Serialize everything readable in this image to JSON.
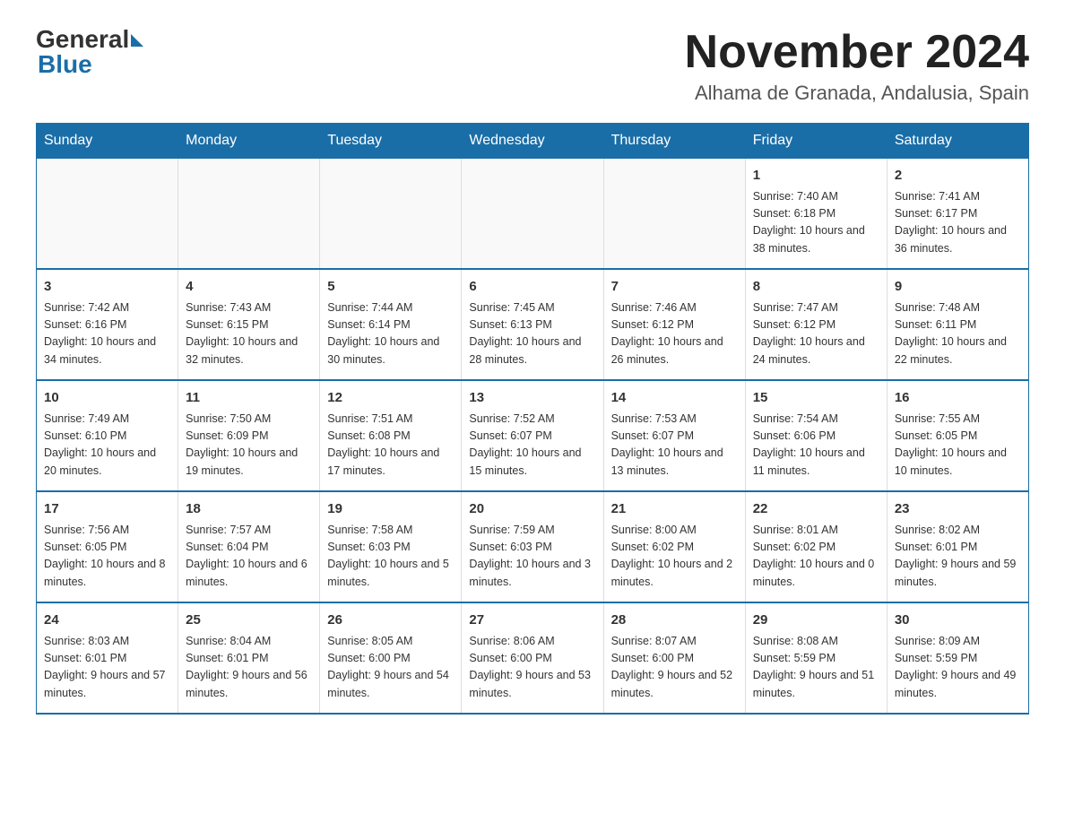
{
  "logo": {
    "general": "General",
    "blue": "Blue"
  },
  "title": "November 2024",
  "subtitle": "Alhama de Granada, Andalusia, Spain",
  "days_of_week": [
    "Sunday",
    "Monday",
    "Tuesday",
    "Wednesday",
    "Thursday",
    "Friday",
    "Saturday"
  ],
  "weeks": [
    [
      {
        "day": "",
        "info": ""
      },
      {
        "day": "",
        "info": ""
      },
      {
        "day": "",
        "info": ""
      },
      {
        "day": "",
        "info": ""
      },
      {
        "day": "",
        "info": ""
      },
      {
        "day": "1",
        "info": "Sunrise: 7:40 AM\nSunset: 6:18 PM\nDaylight: 10 hours and 38 minutes."
      },
      {
        "day": "2",
        "info": "Sunrise: 7:41 AM\nSunset: 6:17 PM\nDaylight: 10 hours and 36 minutes."
      }
    ],
    [
      {
        "day": "3",
        "info": "Sunrise: 7:42 AM\nSunset: 6:16 PM\nDaylight: 10 hours and 34 minutes."
      },
      {
        "day": "4",
        "info": "Sunrise: 7:43 AM\nSunset: 6:15 PM\nDaylight: 10 hours and 32 minutes."
      },
      {
        "day": "5",
        "info": "Sunrise: 7:44 AM\nSunset: 6:14 PM\nDaylight: 10 hours and 30 minutes."
      },
      {
        "day": "6",
        "info": "Sunrise: 7:45 AM\nSunset: 6:13 PM\nDaylight: 10 hours and 28 minutes."
      },
      {
        "day": "7",
        "info": "Sunrise: 7:46 AM\nSunset: 6:12 PM\nDaylight: 10 hours and 26 minutes."
      },
      {
        "day": "8",
        "info": "Sunrise: 7:47 AM\nSunset: 6:12 PM\nDaylight: 10 hours and 24 minutes."
      },
      {
        "day": "9",
        "info": "Sunrise: 7:48 AM\nSunset: 6:11 PM\nDaylight: 10 hours and 22 minutes."
      }
    ],
    [
      {
        "day": "10",
        "info": "Sunrise: 7:49 AM\nSunset: 6:10 PM\nDaylight: 10 hours and 20 minutes."
      },
      {
        "day": "11",
        "info": "Sunrise: 7:50 AM\nSunset: 6:09 PM\nDaylight: 10 hours and 19 minutes."
      },
      {
        "day": "12",
        "info": "Sunrise: 7:51 AM\nSunset: 6:08 PM\nDaylight: 10 hours and 17 minutes."
      },
      {
        "day": "13",
        "info": "Sunrise: 7:52 AM\nSunset: 6:07 PM\nDaylight: 10 hours and 15 minutes."
      },
      {
        "day": "14",
        "info": "Sunrise: 7:53 AM\nSunset: 6:07 PM\nDaylight: 10 hours and 13 minutes."
      },
      {
        "day": "15",
        "info": "Sunrise: 7:54 AM\nSunset: 6:06 PM\nDaylight: 10 hours and 11 minutes."
      },
      {
        "day": "16",
        "info": "Sunrise: 7:55 AM\nSunset: 6:05 PM\nDaylight: 10 hours and 10 minutes."
      }
    ],
    [
      {
        "day": "17",
        "info": "Sunrise: 7:56 AM\nSunset: 6:05 PM\nDaylight: 10 hours and 8 minutes."
      },
      {
        "day": "18",
        "info": "Sunrise: 7:57 AM\nSunset: 6:04 PM\nDaylight: 10 hours and 6 minutes."
      },
      {
        "day": "19",
        "info": "Sunrise: 7:58 AM\nSunset: 6:03 PM\nDaylight: 10 hours and 5 minutes."
      },
      {
        "day": "20",
        "info": "Sunrise: 7:59 AM\nSunset: 6:03 PM\nDaylight: 10 hours and 3 minutes."
      },
      {
        "day": "21",
        "info": "Sunrise: 8:00 AM\nSunset: 6:02 PM\nDaylight: 10 hours and 2 minutes."
      },
      {
        "day": "22",
        "info": "Sunrise: 8:01 AM\nSunset: 6:02 PM\nDaylight: 10 hours and 0 minutes."
      },
      {
        "day": "23",
        "info": "Sunrise: 8:02 AM\nSunset: 6:01 PM\nDaylight: 9 hours and 59 minutes."
      }
    ],
    [
      {
        "day": "24",
        "info": "Sunrise: 8:03 AM\nSunset: 6:01 PM\nDaylight: 9 hours and 57 minutes."
      },
      {
        "day": "25",
        "info": "Sunrise: 8:04 AM\nSunset: 6:01 PM\nDaylight: 9 hours and 56 minutes."
      },
      {
        "day": "26",
        "info": "Sunrise: 8:05 AM\nSunset: 6:00 PM\nDaylight: 9 hours and 54 minutes."
      },
      {
        "day": "27",
        "info": "Sunrise: 8:06 AM\nSunset: 6:00 PM\nDaylight: 9 hours and 53 minutes."
      },
      {
        "day": "28",
        "info": "Sunrise: 8:07 AM\nSunset: 6:00 PM\nDaylight: 9 hours and 52 minutes."
      },
      {
        "day": "29",
        "info": "Sunrise: 8:08 AM\nSunset: 5:59 PM\nDaylight: 9 hours and 51 minutes."
      },
      {
        "day": "30",
        "info": "Sunrise: 8:09 AM\nSunset: 5:59 PM\nDaylight: 9 hours and 49 minutes."
      }
    ]
  ]
}
